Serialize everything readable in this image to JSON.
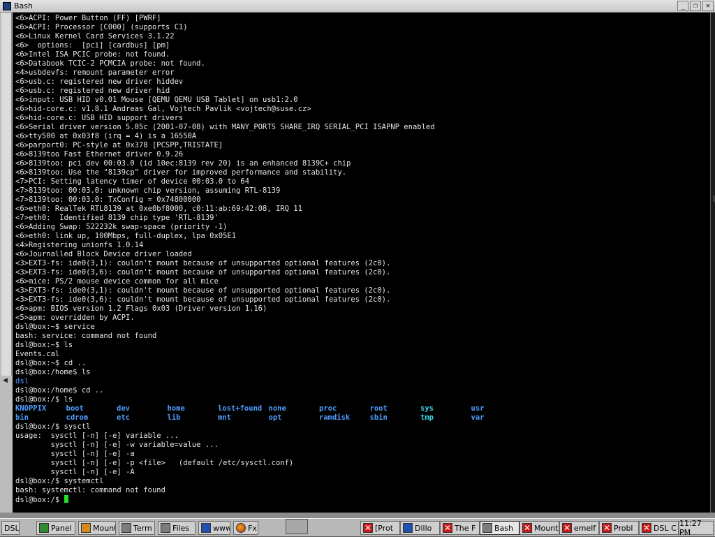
{
  "window": {
    "title": "Bash",
    "buttons": {
      "minimize": "_",
      "maximize": "❐",
      "close": "✕"
    }
  },
  "console": {
    "lines": [
      "<6>ACPI: Power Button (FF) [PWRF]",
      "<6>ACPI: Processor [C000] (supports C1)",
      "<6>Linux Kernel Card Services 3.1.22",
      "<6>  options:  [pci] [cardbus] [pm]",
      "<6>Intel ISA PCIC probe: not found.",
      "<6>Databook TCIC-2 PCMCIA probe: not found.",
      "<4>usbdevfs: remount parameter error",
      "<6>usb.c: registered new driver hiddev",
      "<6>usb.c: registered new driver hid",
      "<6>input: USB HID v0.01 Mouse [QEMU QEMU USB Tablet] on usb1:2.0",
      "<6>hid-core.c: v1.8.1 Andreas Gal, Vojtech Pavlik <vojtech@suse.cz>",
      "<6>hid-core.c: USB HID support drivers",
      "<6>Serial driver version 5.05c (2001-07-08) with MANY_PORTS SHARE_IRQ SERIAL_PCI ISAPNP enabled",
      "<6>tty500 at 0x03f8 (irq = 4) is a 16550A",
      "<6>parport0: PC-style at 0x378 [PCSPP,TRISTATE]",
      "<6>8139too Fast Ethernet driver 0.9.26",
      "<6>8139too: pci dev 00:03.0 (id 10ec:8139 rev 20) is an enhanced 8139C+ chip",
      "<6>8139too: Use the \"8139cp\" driver for improved performance and stability.",
      "<7>PCI: Setting latency timer of device 00:03.0 to 64",
      "<7>8139too: 00:03.0: unknown chip version, assuming RTL-8139",
      "<7>8139too: 00:03.0: TxConfig = 0x74800000",
      "<6>eth0: RealTek RTL8139 at 0xe0bf8000, c0:11:ab:69:42:08, IRQ 11",
      "<7>eth0:  Identified 8139 chip type 'RTL-8139'",
      "<6>Adding Swap: 522232k swap-space (priority -1)",
      "<6>eth0: link up, 100Mbps, full-duplex, lpa 0x05E1",
      "<4>Registering unionfs 1.0.14",
      "<6>Journalled Block Device driver loaded",
      "<3>EXT3-fs: ide0(3,1): couldn't mount because of unsupported optional features (2c0).",
      "<3>EXT3-fs: ide0(3,6): couldn't mount because of unsupported optional features (2c0).",
      "<6>mice: PS/2 mouse device common for all mice",
      "<3>EXT3-fs: ide0(3,1): couldn't mount because of unsupported optional features (2c0).",
      "<3>EXT3-fs: ide0(3,6): couldn't mount because of unsupported optional features (2c0).",
      "<6>apm: BIOS version 1.2 Flags 0x03 (Driver version 1.16)",
      "<5>apm: overridden by ACPI.",
      "dsl@box:~$ service",
      "bash: service: command not found",
      "dsl@box:~$ ls",
      "Events.cal",
      "dsl@box:~$ cd ..",
      "dsl@box:/home$ ls"
    ],
    "dir_line": "dsl",
    "after_lines": [
      "dsl@box:/home$ cd ..",
      "dsl@box:/$ ls"
    ],
    "ls_rows": [
      [
        "KNOPPIX",
        "boot",
        "dev",
        "home",
        "lost+found",
        "none",
        "proc",
        "root",
        "sys",
        "usr"
      ],
      [
        "bin",
        "cdrom",
        "etc",
        "lib",
        "mnt",
        "opt",
        "ramdisk",
        "sbin",
        "tmp",
        "var"
      ]
    ],
    "ls_cyan": [
      "sys",
      "tmp"
    ],
    "tail_lines": [
      "dsl@box:/$ sysctl",
      "usage:  sysctl [-n] [-e] variable ...",
      "        sysctl [-n] [-e] -w variable=value ...",
      "        sysctl [-n] [-e] -a",
      "        sysctl [-n] [-e] -p <file>   (default /etc/sysctl.conf)",
      "        sysctl [-n] [-e] -A",
      "dsl@box:/$ systemctl",
      "bash: systemctl: command not found"
    ],
    "prompt": "dsl@box:/$ "
  },
  "taskbar": {
    "start": "DSL",
    "launchers": [
      {
        "label": "Panel",
        "icon": "panel-icon"
      },
      {
        "label": "Mount",
        "icon": "mount-icon"
      },
      {
        "label": "Term",
        "icon": "terminal-icon"
      },
      {
        "label": "Files",
        "icon": "files-icon"
      },
      {
        "label": "www",
        "icon": "browser-icon"
      },
      {
        "label": "Fx",
        "icon": "firefox-icon"
      }
    ],
    "tasks": [
      {
        "label": "[Prot",
        "icon": "x-icon"
      },
      {
        "label": "Dillo",
        "icon": "dillo-icon"
      },
      {
        "label": "The F",
        "icon": "x-icon"
      },
      {
        "label": "Bash",
        "icon": "bash-icon"
      },
      {
        "label": "Mount",
        "icon": "x-icon"
      },
      {
        "label": "emelf",
        "icon": "x-icon"
      },
      {
        "label": "Probl",
        "icon": "x-icon"
      },
      {
        "label": "DSL C",
        "icon": "x-icon"
      }
    ],
    "clock": "11:27 PM"
  }
}
